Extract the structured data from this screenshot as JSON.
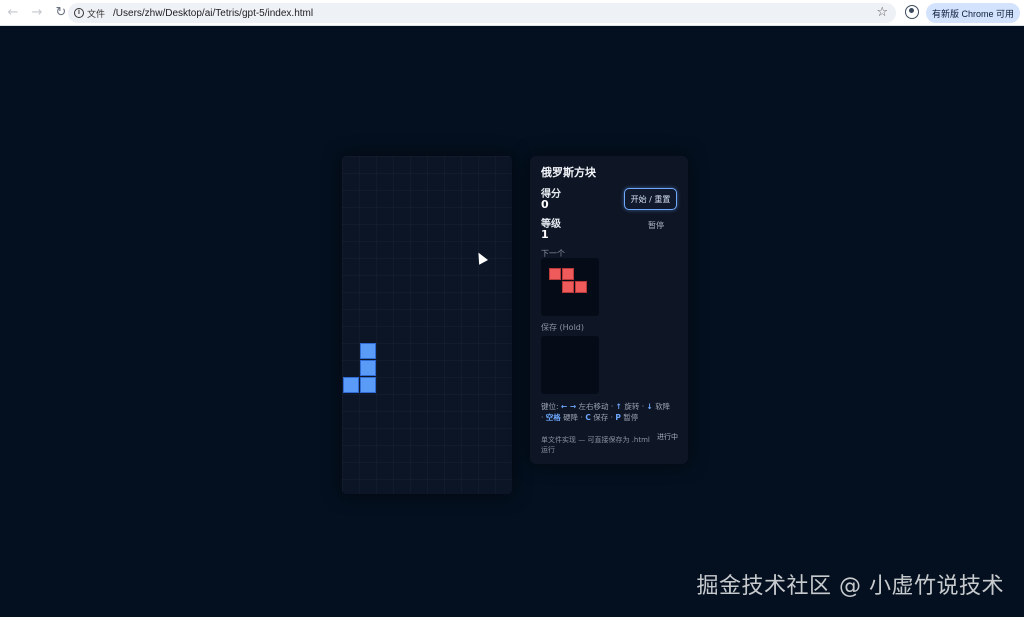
{
  "browser": {
    "file_label": "文件",
    "url": "/Users/zhw/Desktop/ai/Tetris/gpt-5/index.html",
    "update_label": "有新版 Chrome 可用"
  },
  "game": {
    "title": "俄罗斯方块",
    "score_label": "得分",
    "score": "0",
    "level_label": "等级",
    "level": "1",
    "start_reset_label": "开始 / 重置",
    "pause_label": "暂停",
    "next_label": "下一个",
    "hold_label": "保存 (Hold)",
    "controls": {
      "prefix": "键位:",
      "left_right": "← →",
      "move": "左右移动",
      "up": "↑",
      "rotate": "旋转",
      "down": "↓",
      "soft_drop": "软降",
      "space": "空格",
      "hard_drop": "硬降",
      "c": "C",
      "hold": "保存",
      "p": "P",
      "pause": "暂停"
    },
    "footer": "单文件实现 — 可直接保存为 .html 运行",
    "status": "进行中",
    "next_piece": "Z",
    "current_piece": "J"
  },
  "watermark": "掘金技术社区 @ 小虚竹说技术",
  "colors": {
    "background": "#04101f",
    "piece_blue": "#5b9bf8",
    "piece_red": "#ef5b5b",
    "accent": "#6ea8ff"
  }
}
